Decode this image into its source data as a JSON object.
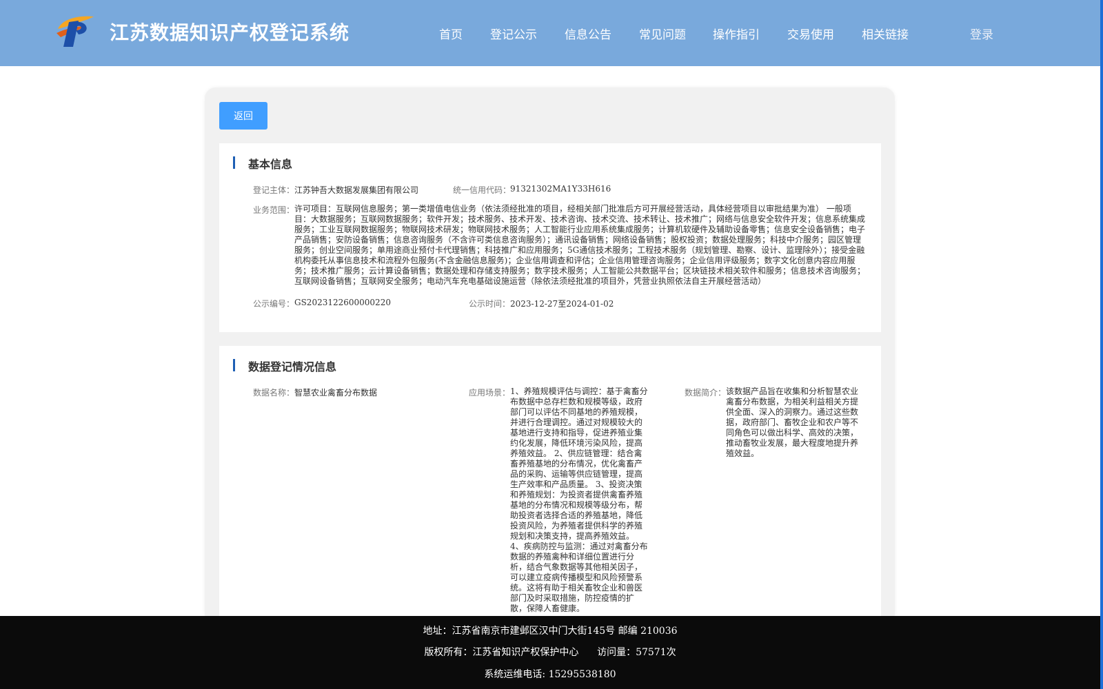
{
  "header": {
    "title": "江苏数据知识产权登记系统",
    "nav": [
      "首页",
      "登记公示",
      "信息公告",
      "常见问题",
      "操作指引",
      "交易使用",
      "相关链接"
    ],
    "login": "登录"
  },
  "back_button": "返回",
  "basic_info": {
    "section_title": "基本信息",
    "entity_label": "登记主体：",
    "entity_value": "江苏钟吾大数据发展集团有限公司",
    "credit_code_label": "统一信用代码：",
    "credit_code_value": "91321302MA1Y33H616",
    "scope_label": "业务范围：",
    "scope_value": "许可项目：互联网信息服务；第一类增值电信业务（依法须经批准的项目，经相关部门批准后方可开展经营活动，具体经营项目以审批结果为准） 一般项目：大数据服务；互联网数据服务；软件开发；技术服务、技术开发、技术咨询、技术交流、技术转让、技术推广；网络与信息安全软件开发；信息系统集成服务；工业互联网数据服务；物联网技术研发；物联网技术服务；人工智能行业应用系统集成服务；计算机软硬件及辅助设备零售；信息安全设备销售；电子产品销售；安防设备销售；信息咨询服务（不含许可类信息咨询服务）；通讯设备销售；网络设备销售；股权投资；数据处理服务；科技中介服务；园区管理服务；创业空间服务；单用途商业预付卡代理销售；科技推广和应用服务；5G通信技术服务；工程技术服务（规划管理、勘察、设计、监理除外）；接受金融机构委托从事信息技术和流程外包服务(不含金融信息服务)；企业信用调查和评估；企业信用管理咨询服务；企业信用评级服务；数字文化创意内容应用服务；技术推广服务；云计算设备销售；数据处理和存储支持服务；数字技术服务；人工智能公共数据平台；区块链技术相关软件和服务；信息技术咨询服务；互联网设备销售；互联网安全服务；电动汽车充电基础设施运营（除依法须经批准的项目外，凭营业执照依法自主开展经营活动）",
    "notice_no_label": "公示编号：",
    "notice_no_value": "GS2023122600000220",
    "notice_time_label": "公示时间：",
    "notice_time_value": "2023-12-27至2024-01-02"
  },
  "data_info": {
    "section_title": "数据登记情况信息",
    "name_label": "数据名称：",
    "name_value": "智慧农业禽畜分布数据",
    "scenario_label": "应用场景：",
    "scenario_value": "1、养殖规模评估与调控：基于禽畜分布数据中总存栏数和规模等级，政府部门可以评估不同基地的养殖规模，并进行合理调控。通过对规模较大的基地进行支持和指导，促进养殖业集约化发展，降低环境污染风险，提高养殖效益。 2、供应链管理：结合禽畜养殖基地的分布情况，优化禽畜产品的采购、运输等供应链管理，提高生产效率和产品质量。 3、投资决策和养殖规划：为投资者提供禽畜养殖基地的分布情况和规模等级分布，帮助投资者选择合适的养殖基地，降低投资风险，为养殖者提供科学的养殖规划和决策支持，提高养殖效益。 4、疾病防控与监测：通过对禽畜分布数据的养殖禽种和详细位置进行分析，结合气象数据等其他相关因子，可以建立疫病传播模型和风险预警系统。这将有助于相关畜牧企业和兽医部门及时采取措施，防控疫情的扩散，保障人畜健康。",
    "intro_label": "数据简介：",
    "intro_value": "该数据产品旨在收集和分析智慧农业禽畜分布数据，为相关利益相关方提供全面、深入的洞察力。通过这些数据，政府部门、畜牧企业和农户等不同角色可以做出科学、高效的决策，推动畜牧业发展，最大程度地提升养殖效益。"
  },
  "footer": {
    "address": "地址：江苏省南京市建邺区汉中门大街145号 邮编 210036",
    "copyright": "版权所有：江苏省知识产权保护中心      访问量：57571次",
    "phone": "系统运维电话: 15295538180"
  },
  "colors": {
    "header_bg": "#79a9dc",
    "button_blue": "#409eff",
    "section_bar": "#1e5fb4",
    "footer_bg": "#0b0b0b"
  },
  "icons": {
    "logo": "p-logo-icon"
  }
}
